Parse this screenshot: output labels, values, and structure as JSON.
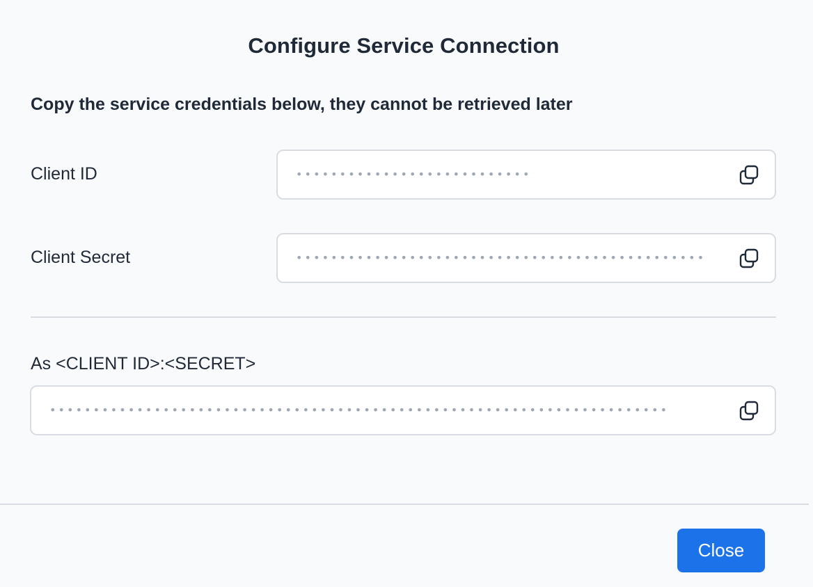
{
  "dialog": {
    "title": "Configure Service Connection",
    "instruction": "Copy the service credentials below, they cannot be retrieved later"
  },
  "fields": {
    "client_id": {
      "label": "Client ID",
      "value": "•••••••••••••••••••••••••••",
      "copy_icon": "copy-icon"
    },
    "client_secret": {
      "label": "Client Secret",
      "value": "•••••••••••••••••••••••••••••••••••••••••••••••",
      "copy_icon": "copy-icon"
    },
    "combined": {
      "label": "As <CLIENT ID>:<SECRET>",
      "value": "•••••••••••••••••••••••••••••••••••••••••••••••••••••••••••••••••••••••",
      "copy_icon": "copy-icon"
    }
  },
  "footer": {
    "close_label": "Close"
  },
  "colors": {
    "primary": "#1c72e8",
    "background": "#f9fafb",
    "border": "#d9dce3",
    "text": "#1f2937",
    "masked_text": "#a0a7b4"
  }
}
